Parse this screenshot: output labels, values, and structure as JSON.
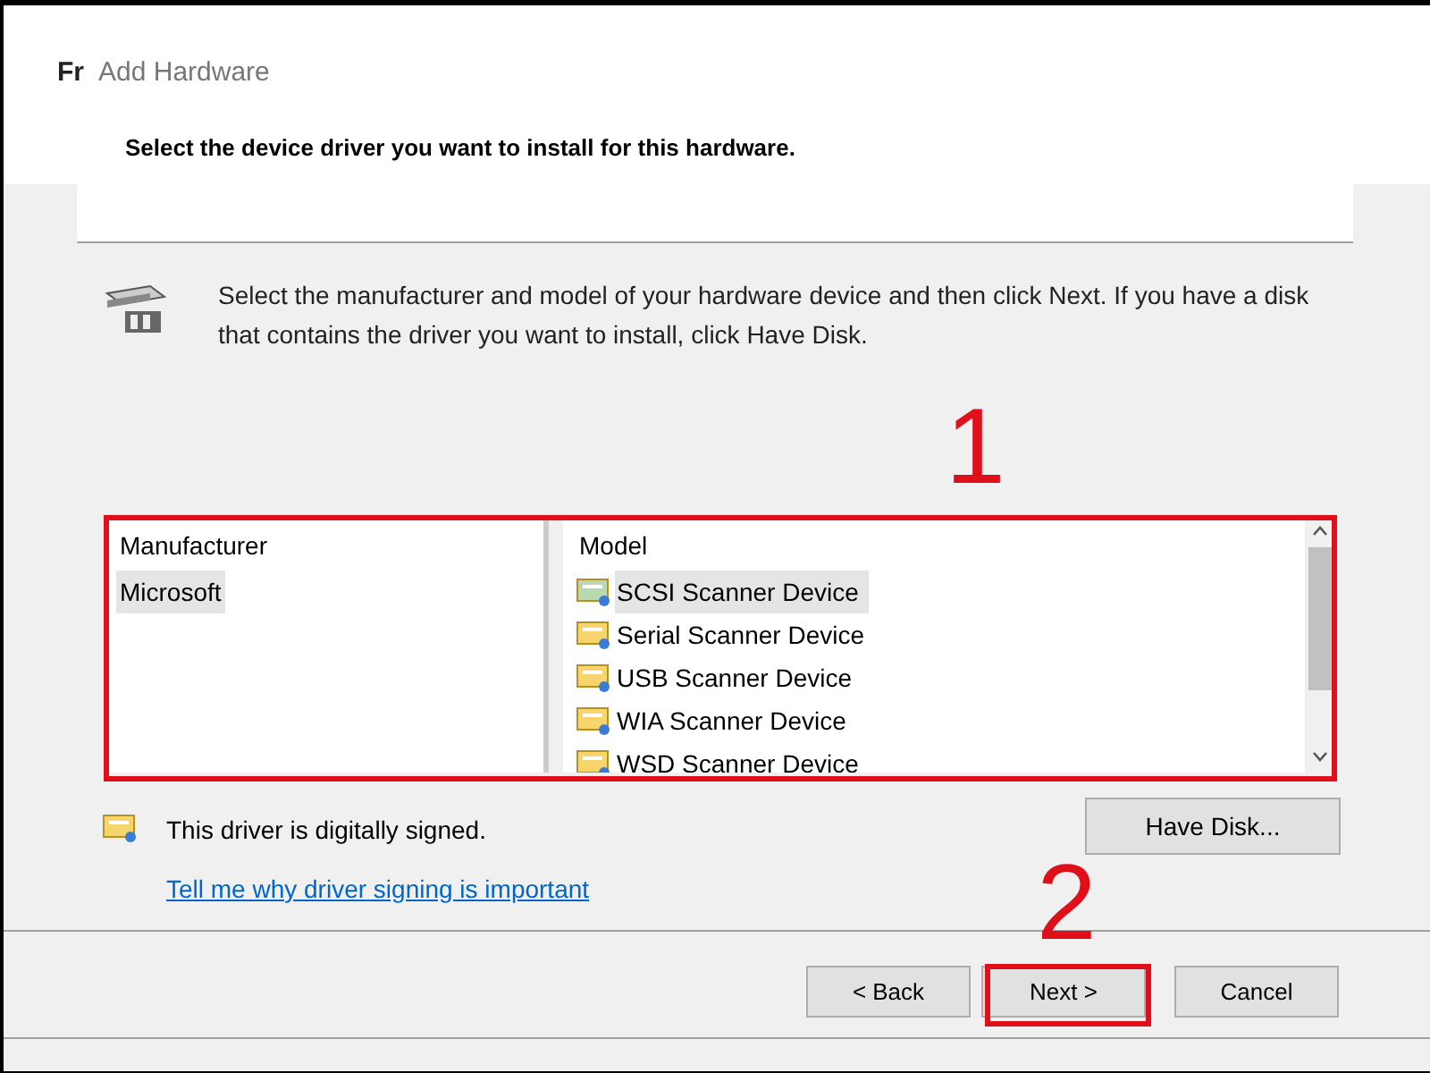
{
  "window": {
    "title_prefix": "Fr",
    "title": "Add Hardware"
  },
  "header": {
    "heading": "Select the device driver you want to install for this hardware."
  },
  "instructions": "Select the manufacturer and model of your hardware device and then click Next. If you have a disk that contains the driver you want to install, click Have Disk.",
  "manufacturer_list": {
    "heading": "Manufacturer",
    "items": [
      {
        "label": "Microsoft",
        "selected": true
      }
    ]
  },
  "model_list": {
    "heading": "Model",
    "items": [
      {
        "label": "SCSI Scanner Device",
        "selected": true
      },
      {
        "label": "Serial Scanner Device",
        "selected": false
      },
      {
        "label": "USB Scanner Device",
        "selected": false
      },
      {
        "label": "WIA Scanner Device",
        "selected": false
      },
      {
        "label": "WSD Scanner Device",
        "selected": false
      }
    ]
  },
  "signature": {
    "text": "This driver is digitally signed.",
    "link": "Tell me why driver signing is important"
  },
  "have_disk_button": "Have Disk...",
  "buttons": [
    {
      "label": "< Back"
    },
    {
      "label": "Next >"
    },
    {
      "label": "Cancel"
    }
  ],
  "annotations": [
    {
      "label": "1",
      "kind": "lists"
    },
    {
      "label": "2",
      "kind": "next"
    }
  ]
}
